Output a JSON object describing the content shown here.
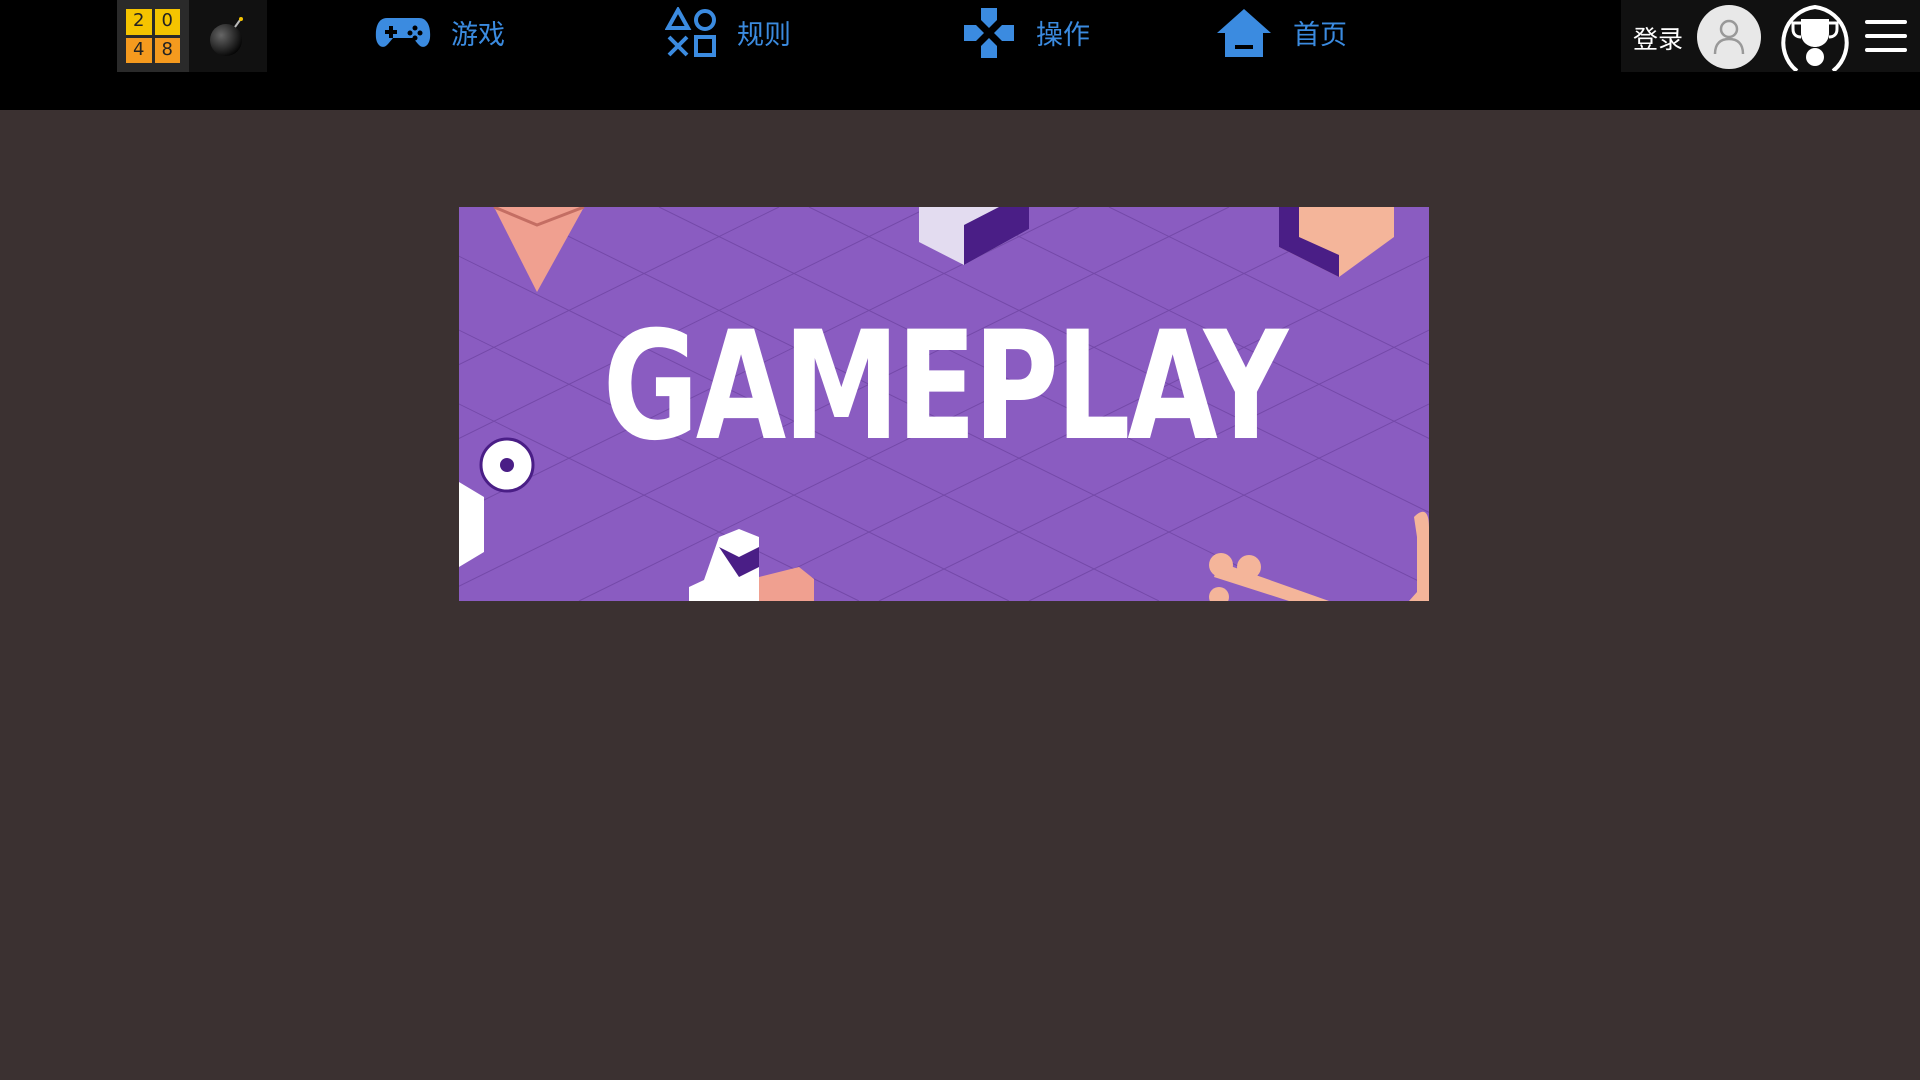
{
  "header": {
    "logo_tiles": [
      "2",
      "0",
      "4",
      "8"
    ],
    "nav": [
      {
        "label": "游戏",
        "icon": "gamepad-icon"
      },
      {
        "label": "规则",
        "icon": "playstation-shapes-icon"
      },
      {
        "label": "操作",
        "icon": "dpad-icon"
      },
      {
        "label": "首页",
        "icon": "home-icon"
      }
    ],
    "login_label": "登录",
    "accent_color": "#3b8be0"
  },
  "banner": {
    "title": "GAMEPLAY",
    "background_color": "#8a5cc1"
  }
}
